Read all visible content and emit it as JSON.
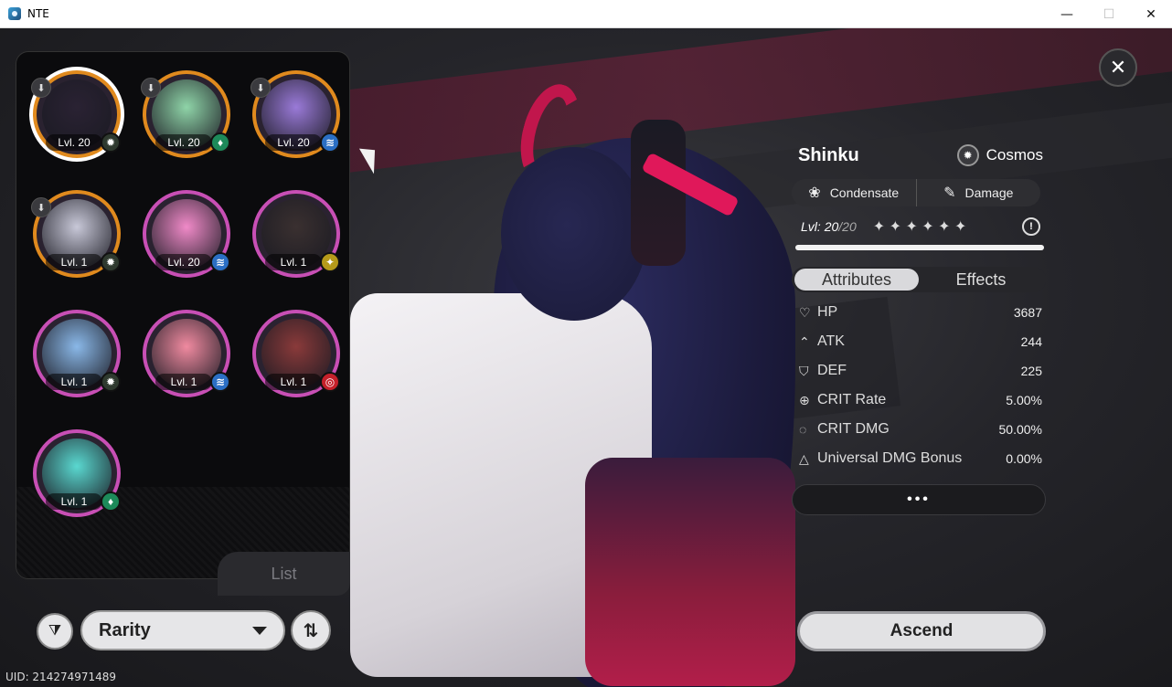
{
  "window": {
    "title": "NTE",
    "minimize": "—",
    "maximize": "☐",
    "close": "✕"
  },
  "roster": {
    "tab_label": "List",
    "characters": [
      {
        "level": "Lvl. 20",
        "rarity": "rare5",
        "element_glyph": "✹",
        "element_color": "#2f3a2f",
        "selected": true,
        "downloadable": true
      },
      {
        "level": "Lvl. 20",
        "rarity": "rare5",
        "element_glyph": "♦",
        "element_color": "#1d8a5a",
        "selected": false,
        "downloadable": true
      },
      {
        "level": "Lvl. 20",
        "rarity": "rare5",
        "element_glyph": "≋",
        "element_color": "#2b6fc4",
        "selected": false,
        "downloadable": true
      },
      {
        "level": "Lvl. 1",
        "rarity": "rare5",
        "element_glyph": "✹",
        "element_color": "#2f3a2f",
        "selected": false,
        "downloadable": true
      },
      {
        "level": "Lvl. 20",
        "rarity": "rare4",
        "element_glyph": "≋",
        "element_color": "#2b6fc4",
        "selected": false,
        "downloadable": false
      },
      {
        "level": "Lvl. 1",
        "rarity": "rare4",
        "element_glyph": "✦",
        "element_color": "#b59a1a",
        "selected": false,
        "downloadable": false
      },
      {
        "level": "Lvl. 1",
        "rarity": "rare4",
        "element_glyph": "✹",
        "element_color": "#2f3a2f",
        "selected": false,
        "downloadable": false
      },
      {
        "level": "Lvl. 1",
        "rarity": "rare4",
        "element_glyph": "≋",
        "element_color": "#2b6fc4",
        "selected": false,
        "downloadable": false
      },
      {
        "level": "Lvl. 1",
        "rarity": "rare4",
        "element_glyph": "◎",
        "element_color": "#c4202a",
        "selected": false,
        "downloadable": false
      },
      {
        "level": "Lvl. 1",
        "rarity": "rare4",
        "element_glyph": "♦",
        "element_color": "#1d8a5a",
        "selected": false,
        "downloadable": false
      }
    ]
  },
  "controls": {
    "filter_icon": "filter-icon",
    "rarity_value": "Rarity",
    "sort_icon": "sort-icon"
  },
  "uid": "UID: 214274971489",
  "detail": {
    "name": "Shinku",
    "element": "Cosmos",
    "role1": "Condensate",
    "role2": "Damage",
    "level_label": "Lvl: ",
    "level_current": "20",
    "level_max": "/20",
    "stars": "✦ ✦ ✦ ✦ ✦ ✦",
    "info": "!",
    "xp_progress": 1.0,
    "tabs": {
      "attributes": "Attributes",
      "effects": "Effects"
    },
    "attributes": [
      {
        "icon": "♡",
        "name": "HP",
        "value": "3687"
      },
      {
        "icon": "⌃",
        "name": "ATK",
        "value": "244"
      },
      {
        "icon": "⛉",
        "name": "DEF",
        "value": "225"
      },
      {
        "icon": "⊕",
        "name": "CRIT Rate",
        "value": "5.00%"
      },
      {
        "icon": "◌",
        "name": "CRIT DMG",
        "value": "50.00%"
      },
      {
        "icon": "△",
        "name": "Universal DMG Bonus",
        "value": "0.00%"
      }
    ],
    "more": "•••",
    "ascend_label": "Ascend"
  }
}
